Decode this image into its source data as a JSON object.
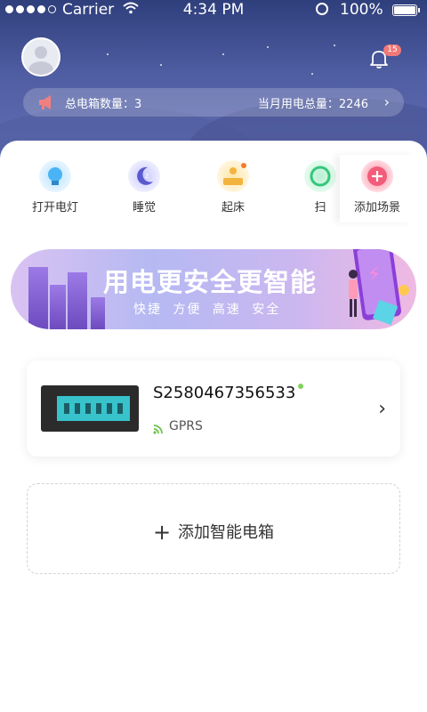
{
  "status_bar": {
    "carrier": "Carrier",
    "time": "4:34 PM",
    "battery": "100%"
  },
  "header": {
    "notification_count": "15",
    "total_boxes_label": "总电箱数量：3",
    "monthly_usage_label": "当月用电总量：2246",
    "chevron": "›"
  },
  "quick_actions": [
    {
      "label": "打开电灯",
      "icon": "lightbulb-icon",
      "color": "#4ab3f4"
    },
    {
      "label": "睡觉",
      "icon": "moon-icon",
      "color": "#5a5acf"
    },
    {
      "label": "起床",
      "icon": "wake-up-icon",
      "color": "#f3b43d"
    },
    {
      "label": "扫",
      "icon": "sweep-icon",
      "color": "#34c77b"
    },
    {
      "label": "添加场景",
      "icon": "add-scene-icon",
      "color": "#f25c7a"
    }
  ],
  "banner": {
    "title": "用电更安全更智能",
    "subtitle": "快捷  方便  高速  安全"
  },
  "device": {
    "name": "S2580467356533",
    "connection": "GPRS",
    "status_color": "#7fd25a",
    "chevron": "›"
  },
  "add_box": {
    "label": "添加智能电箱"
  }
}
